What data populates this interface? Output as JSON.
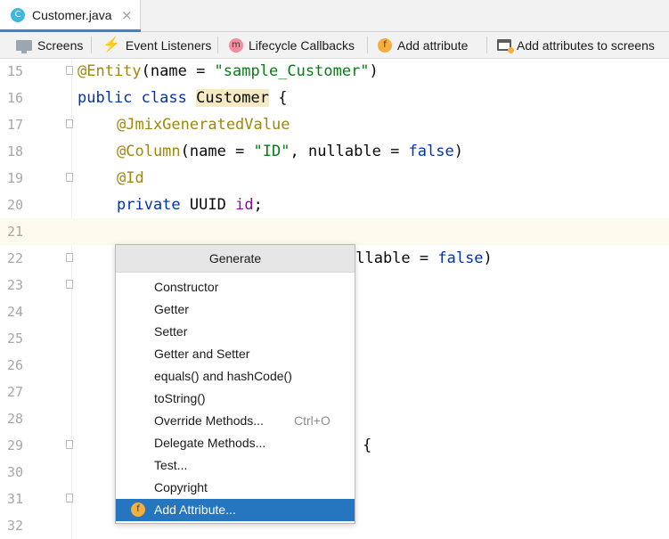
{
  "tab": {
    "label": "Customer.java",
    "icon": "class-icon",
    "icon_letter": "C",
    "close": "×"
  },
  "toolbar": {
    "items": [
      {
        "label": "Screens",
        "icon": "screens-icon"
      },
      {
        "label": "Event Listeners",
        "icon": "lightning-icon"
      },
      {
        "label": "Lifecycle Callbacks",
        "icon": "method-icon",
        "icon_letter": "m"
      },
      {
        "label": "Add attribute",
        "icon": "field-icon",
        "icon_letter": "f"
      },
      {
        "label": "Add attributes to screens",
        "icon": "screen-attribute-icon"
      }
    ]
  },
  "editor": {
    "current_line": "21",
    "lines": [
      {
        "num": "15"
      },
      {
        "num": "16"
      },
      {
        "num": "17"
      },
      {
        "num": "18"
      },
      {
        "num": "19"
      },
      {
        "num": "20"
      },
      {
        "num": "21"
      },
      {
        "num": "22"
      },
      {
        "num": "23"
      },
      {
        "num": "24"
      },
      {
        "num": "25"
      },
      {
        "num": "26"
      },
      {
        "num": "27"
      },
      {
        "num": "28"
      },
      {
        "num": "29"
      },
      {
        "num": "30"
      },
      {
        "num": "31"
      },
      {
        "num": "32"
      }
    ],
    "code": {
      "l15": {
        "ann": "@Entity",
        "p1": "(name = ",
        "str": "\"sample_Customer\"",
        "p2": ")"
      },
      "l16": {
        "kw1": "public",
        "kw2": "class",
        "name": "Customer",
        "brace": "{"
      },
      "l17": {
        "ann": "@JmixGeneratedValue"
      },
      "l18": {
        "ann": "@Column",
        "p1": "(name = ",
        "str": "\"ID\"",
        "p2": ", nullable = ",
        "kw": "false",
        "p3": ")"
      },
      "l19": {
        "ann": "@Id"
      },
      "l20": {
        "kw": "private",
        "type": " UUID ",
        "field": "id",
        "semi": ";"
      },
      "l22": {
        "p1": "ullable = ",
        "kw": "false",
        "p2": ")"
      },
      "l29": {
        "brace": "{"
      }
    }
  },
  "popup": {
    "title": "Generate",
    "items": [
      {
        "label": "Constructor",
        "shortcut": ""
      },
      {
        "label": "Getter",
        "shortcut": ""
      },
      {
        "label": "Setter",
        "shortcut": ""
      },
      {
        "label": "Getter and Setter",
        "shortcut": ""
      },
      {
        "label": "equals() and hashCode()",
        "shortcut": ""
      },
      {
        "label": "toString()",
        "shortcut": ""
      },
      {
        "label": "Override Methods...",
        "shortcut": "Ctrl+O"
      },
      {
        "label": "Delegate Methods...",
        "shortcut": ""
      },
      {
        "label": "Test...",
        "shortcut": ""
      },
      {
        "label": "Copyright",
        "shortcut": ""
      },
      {
        "label": "Add Attribute...",
        "shortcut": "",
        "selected": true,
        "icon": "field-icon",
        "icon_letter": "f"
      }
    ]
  },
  "colors": {
    "selection": "#2675bf",
    "keyword": "#0033b3",
    "annotation": "#9e880d",
    "string": "#067d17",
    "field": "#871094"
  }
}
